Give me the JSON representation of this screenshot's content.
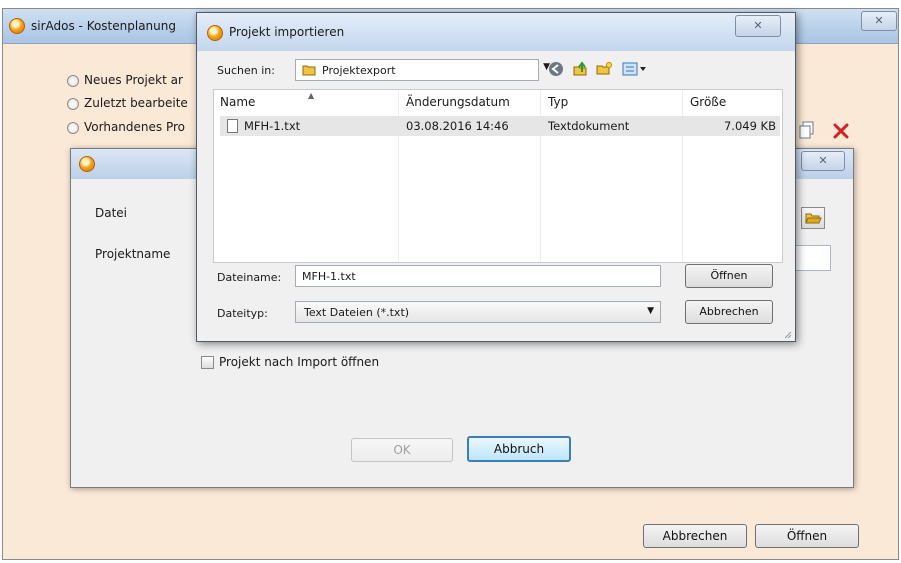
{
  "main_window": {
    "title": "sirAdos - Kostenplanung",
    "close_glyph": "✕",
    "options": [
      {
        "label": "Neues Projekt ar"
      },
      {
        "label": "Zuletzt bearbeite"
      },
      {
        "label": "Vorhandenes Pro"
      }
    ],
    "buttons": {
      "cancel": "Abbrechen",
      "open": "Öffnen"
    },
    "icons": {
      "copy": "copy-icon",
      "delete": "delete-icon"
    },
    "accent_red": "#d42222"
  },
  "import_dialog": {
    "close_glyph": "✕",
    "file_label": "Datei",
    "project_name_label": "Projektname",
    "open_after_import_label": "Projekt nach Import öffnen",
    "ok_label": "OK",
    "cancel_label": "Abbruch"
  },
  "file_dialog": {
    "title": "Projekt importieren",
    "close_glyph": "✕",
    "look_in_label": "Suchen in:",
    "look_in_value": "Projektexport",
    "columns": {
      "name": "Name",
      "date": "Änderungsdatum",
      "type": "Typ",
      "size": "Größe"
    },
    "files": [
      {
        "name": "MFH-1.txt",
        "date": "03.08.2016 14:46",
        "type": "Textdokument",
        "size": "7.049 KB"
      }
    ],
    "filename_label": "Dateiname:",
    "filename_value": "MFH-1.txt",
    "filetype_label": "Dateityp:",
    "filetype_value": "Text Dateien (*.txt)",
    "open_button": "Öffnen",
    "cancel_button": "Abbrechen"
  }
}
